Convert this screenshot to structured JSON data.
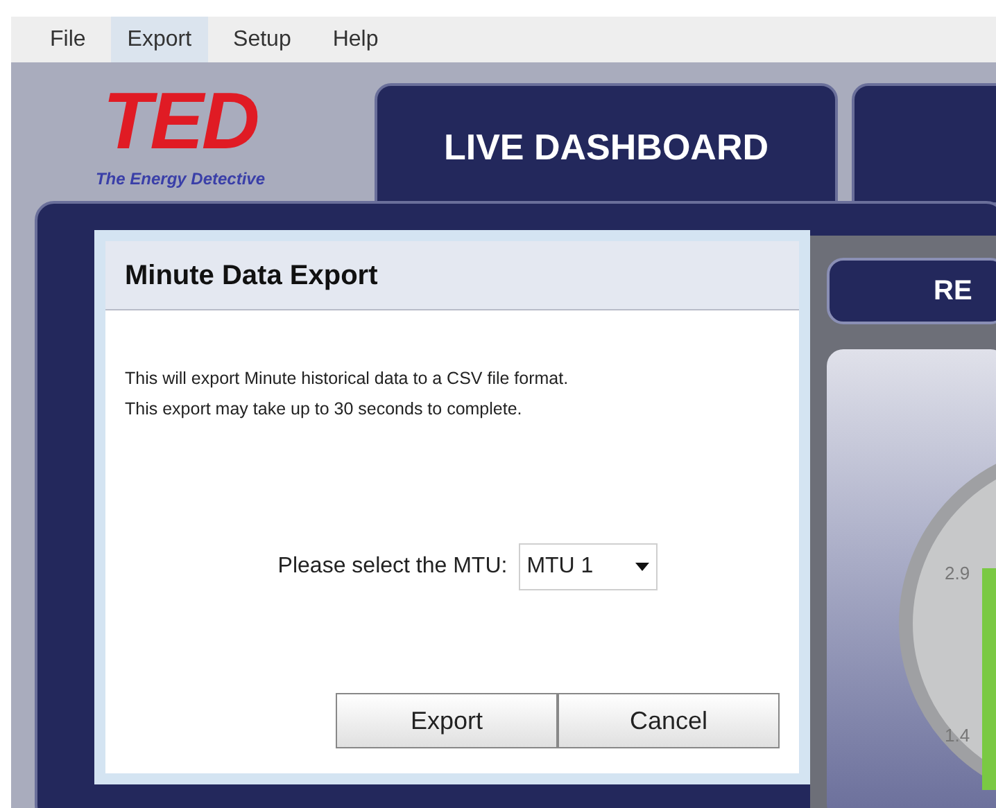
{
  "menu": [
    {
      "label": "File",
      "selected": false
    },
    {
      "label": "Export",
      "selected": true
    },
    {
      "label": "Setup",
      "selected": false
    },
    {
      "label": "Help",
      "selected": false
    }
  ],
  "logo": {
    "text": "TED",
    "tagline": "The Energy Detective"
  },
  "tabs": [
    {
      "label": "LIVE DASHBOARD",
      "selected": true
    }
  ],
  "side_button": {
    "label": "RE"
  },
  "gauge": {
    "labels": [
      "2.9",
      "1.4"
    ]
  },
  "dialog": {
    "title": "Minute Data Export",
    "message": [
      "This will export Minute historical data to a CSV file format.",
      "This export may take up to 30 seconds to complete."
    ],
    "select_label": "Please select the MTU:",
    "select_value": "MTU 1",
    "buttons": [
      "Export",
      "Cancel"
    ]
  }
}
